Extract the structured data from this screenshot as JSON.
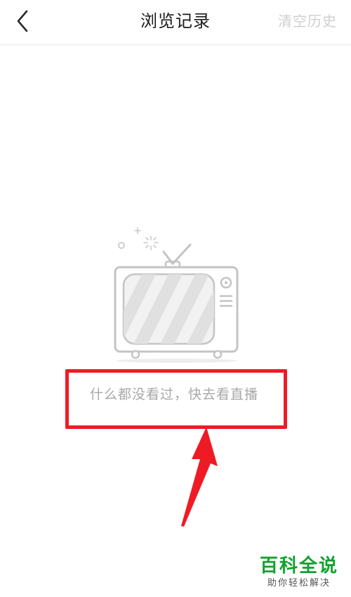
{
  "header": {
    "title": "浏览记录",
    "clear_history_label": "清空历史",
    "back_icon": "chevron-left-icon"
  },
  "empty_state": {
    "illustration_icon": "tv-icon",
    "message": "什么都没看过，快去看直播"
  },
  "annotation": {
    "highlight_color": "#ef1b24",
    "arrow_icon": "red-arrow-icon"
  },
  "watermark": {
    "main": "百科全说",
    "sub": "助你轻松解决"
  }
}
